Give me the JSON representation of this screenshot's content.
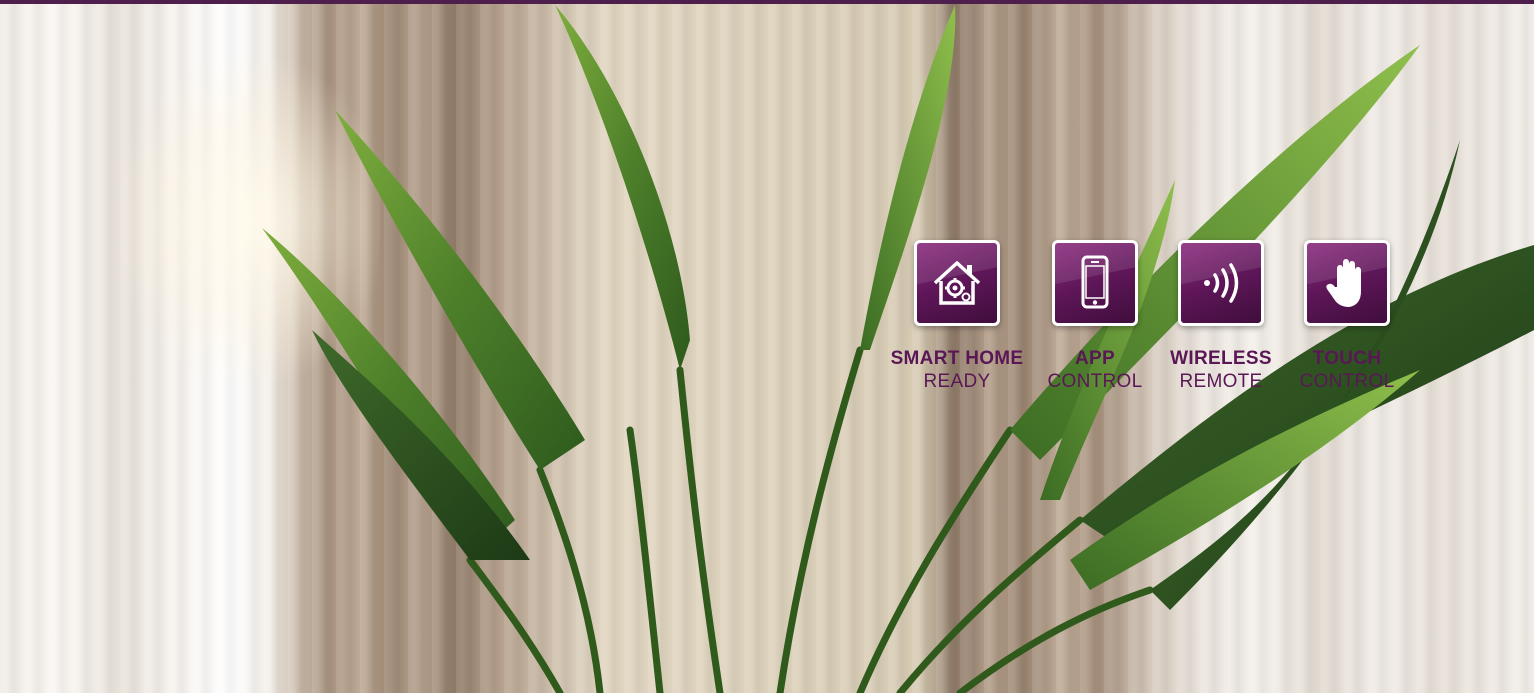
{
  "brand_color": "#5a1756",
  "features": [
    {
      "icon": "smart-home-icon",
      "title": "SMART HOME",
      "subtitle": "READY"
    },
    {
      "icon": "smartphone-icon",
      "title": "APP",
      "subtitle": "CONTROL"
    },
    {
      "icon": "wireless-signal-icon",
      "title": "WIRELESS",
      "subtitle": "REMOTE"
    },
    {
      "icon": "hand-touch-icon",
      "title": "TOUCH",
      "subtitle": "CONTROL"
    }
  ]
}
